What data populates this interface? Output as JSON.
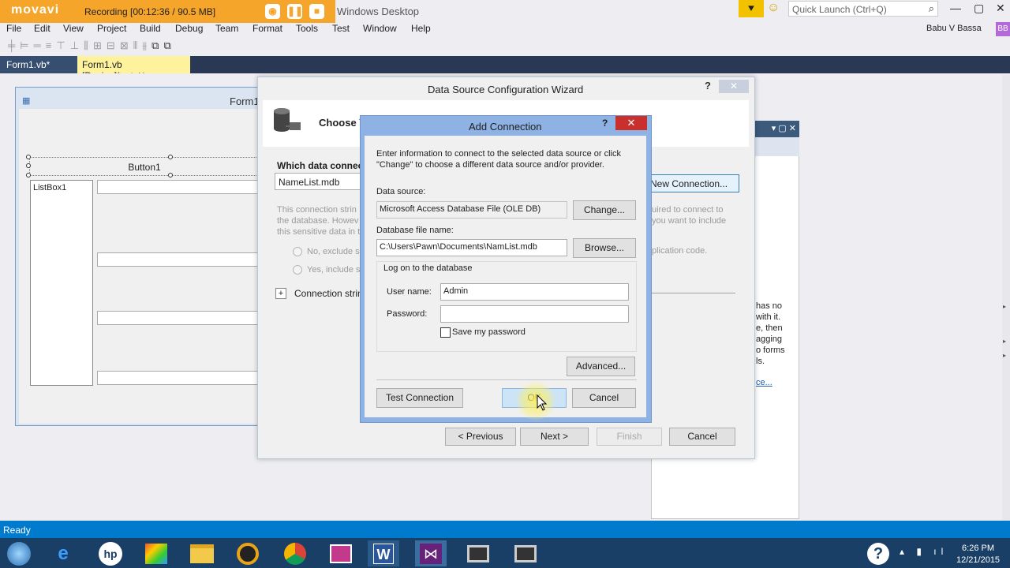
{
  "recorder": {
    "logo": "movavi",
    "status": "Recording  [00:12:36 / 90.5 MB]",
    "buttons": [
      "screenshot-icon",
      "pause-icon",
      "stop-icon"
    ]
  },
  "window": {
    "title": "Windows Desktop",
    "quick_launch_placeholder": "Quick Launch (Ctrl+Q)",
    "user": "Babu V Bassa",
    "user_badge": "BB"
  },
  "menu": [
    "File",
    "Edit",
    "View",
    "Project",
    "Build",
    "Debug",
    "Team",
    "Format",
    "Tools",
    "Test",
    "Window",
    "Help"
  ],
  "tabs": [
    {
      "label": "Form1.vb*"
    },
    {
      "label": "Form1.vb [Design]*",
      "pin": "⊣",
      "close": "✕"
    }
  ],
  "designer": {
    "form_title": "Form1",
    "button_label": "Button1",
    "listbox_label": "ListBox1"
  },
  "wizard": {
    "title": "Data Source Configuration Wizard",
    "help": "?",
    "close": "✕",
    "heading": "Choose Y",
    "which_connection": "Which data connect",
    "connection_value": "NameList.mdb",
    "new_connection": "New Connection...",
    "desc_left": [
      "This connection strin",
      "the database. Howev",
      "this sensitive data in t"
    ],
    "desc_right": [
      "uired to connect to",
      "you want to include"
    ],
    "desc_right2": "plication code.",
    "radio_no": "No, exclude s",
    "radio_yes": "Yes, include s",
    "conn_string_plus": "+",
    "conn_string": "Connection strin",
    "btn_previous": "< Previous",
    "btn_next": "Next >",
    "btn_finish": "Finish",
    "btn_cancel": "Cancel"
  },
  "add_connection": {
    "title": "Add Connection",
    "help": "?",
    "close": "✕",
    "intro": "Enter information to connect to the selected data source or click \"Change\" to choose a different data source and/or provider.",
    "data_source_label": "Data source:",
    "data_source_value": "Microsoft Access Database File (OLE DB)",
    "change_button": "Change...",
    "db_file_label": "Database file name:",
    "db_file_value": "C:\\Users\\Pawn\\Documents\\NamList.mdb",
    "browse_button": "Browse...",
    "logon_group": "Log on to the database",
    "username_label": "User name:",
    "username_value": "Admin",
    "password_label": "Password:",
    "password_value": "",
    "save_password_label": "Save my password",
    "save_password_checked": false,
    "advanced_button": "Advanced...",
    "test_button": "Test Connection",
    "ok_button": "OK",
    "cancel_button": "Cancel"
  },
  "right_panel": {
    "text": [
      "has no",
      "with it.",
      "e, then",
      "agging",
      "o forms",
      "ls."
    ],
    "link": "ce..."
  },
  "status": {
    "text": "Ready"
  },
  "taskbar": {
    "apps": [
      "start-orb-icon",
      "internet-explorer-icon",
      "hp-icon",
      "paint-icon",
      "file-explorer-icon",
      "media-player-icon",
      "chrome-icon",
      "presentation-icon",
      "word-icon",
      "visual-studio-icon",
      "monitor-app-icon",
      "monitor-app-icon"
    ],
    "time": "6:26 PM",
    "date": "12/21/2015"
  },
  "colors": {
    "accent": "#007acc",
    "recorder": "#f5a52a",
    "tab_active": "#fff29d",
    "dialog_frame": "#8db2e3",
    "dialog_close": "#c9302c",
    "taskbar": "#1a3f66"
  }
}
